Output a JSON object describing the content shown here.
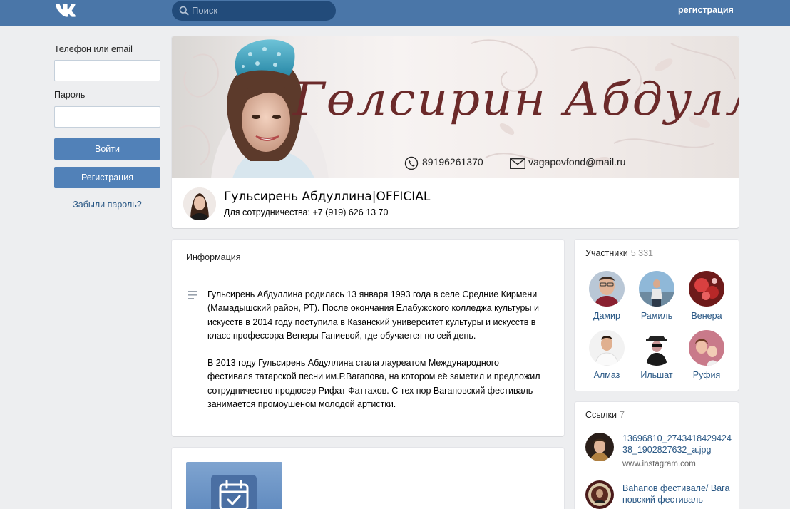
{
  "header": {
    "search_placeholder": "Поиск",
    "register_label": "регистрация"
  },
  "login": {
    "phone_label": "Телефон или email",
    "password_label": "Пароль",
    "login_button": "Войти",
    "register_button": "Регистрация",
    "forgot_link": "Забыли пароль?"
  },
  "cover": {
    "title_script": "Гөлсирин Абдуллина",
    "phone": "89196261370",
    "email": "vagapovfond@mail.ru"
  },
  "page": {
    "name": "Гульсирень Абдуллина|OFFICIAL",
    "status": "Для сотрудничества: +7 (919) 626 13 70"
  },
  "info": {
    "heading": "Информация",
    "paragraphs": [
      "Гульсирень Абдуллина родилась 13 января 1993 года в селе Средние Кирмени (Мамадышский район, РТ). После окончания Елабужского колледжа культуры и искусств в 2014 году поступила в Казанский университет культуры и искусств в класс профессора Венеры Ганиевой, где обучается по сей день.",
      "В 2013 году Гульсирень Абдуллина стала лауреатом Международного фестиваля татарской песни им.Р.Вагапова, на котором её заметил и предложил сотрудничество продюсер Рифат Фаттахов. С тех пор Вагаповский фестиваль занимается промоушеном молодой артистки."
    ]
  },
  "members": {
    "heading": "Участники",
    "count": "5 331",
    "items": [
      {
        "name": "Дамир"
      },
      {
        "name": "Рамиль"
      },
      {
        "name": "Венера"
      },
      {
        "name": "Алмаз"
      },
      {
        "name": "Ильшат"
      },
      {
        "name": "Руфия"
      }
    ]
  },
  "links": {
    "heading": "Ссылки",
    "count": "7",
    "items": [
      {
        "title": "13696810_274341842942438_1902827632_a.jpg",
        "domain": "www.instagram.com"
      },
      {
        "title": "Ваһапов фестивале/ Вагаповский фестиваль",
        "domain": ""
      }
    ]
  },
  "colors": {
    "topbar": "#4a76a8",
    "button": "#5181b8",
    "link": "#2a5885"
  }
}
